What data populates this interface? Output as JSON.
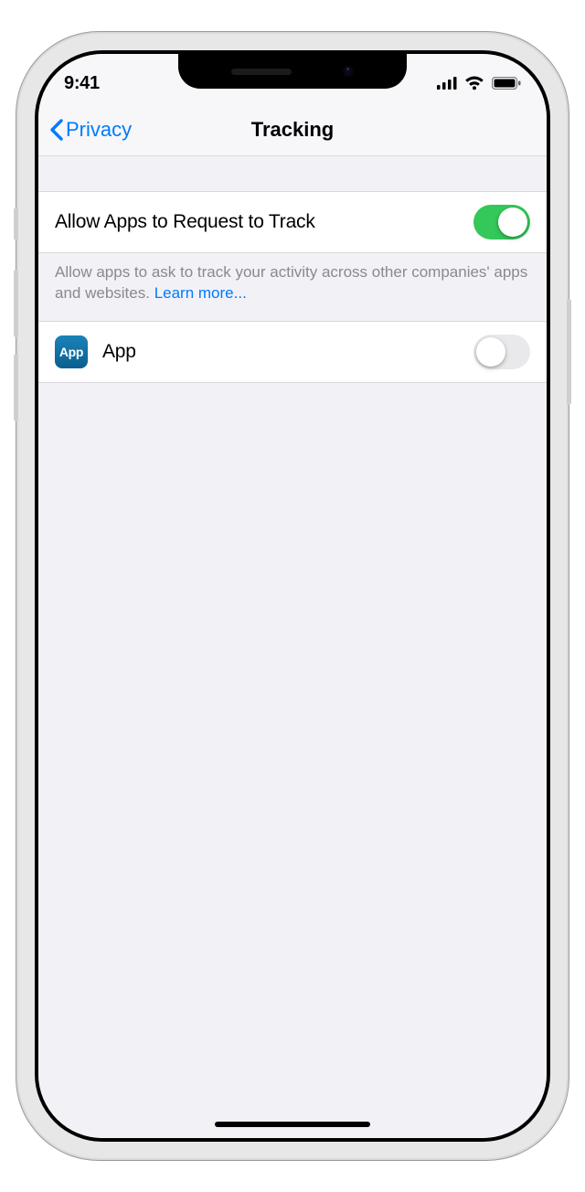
{
  "status": {
    "time": "9:41"
  },
  "nav": {
    "back_label": "Privacy",
    "title": "Tracking"
  },
  "allow": {
    "label": "Allow Apps to Request to Track",
    "enabled": true
  },
  "footer": {
    "text": "Allow apps to ask to track your activity across other companies' apps and websites. ",
    "link_label": "Learn more..."
  },
  "apps": [
    {
      "name": "App",
      "icon_text": "App",
      "enabled": false
    }
  ]
}
